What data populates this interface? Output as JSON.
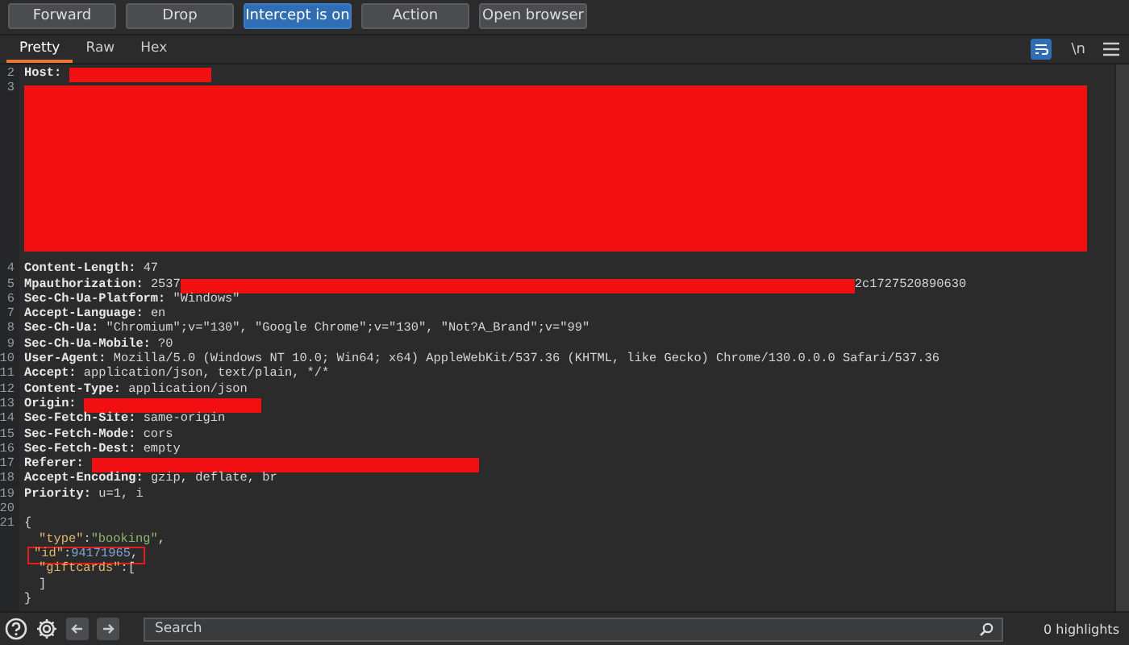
{
  "toolbar": {
    "buttons": [
      {
        "label": "Forward",
        "selected": false
      },
      {
        "label": "Drop",
        "selected": false
      },
      {
        "label": "Intercept is on",
        "selected": true
      },
      {
        "label": "Action",
        "selected": false
      },
      {
        "label": "Open browser",
        "selected": false
      }
    ]
  },
  "view_tabs": [
    {
      "label": "Pretty",
      "selected": true
    },
    {
      "label": "Raw",
      "selected": false
    },
    {
      "label": "Hex",
      "selected": false
    }
  ],
  "view_options": {
    "wrap_lines": {
      "selected": true
    },
    "newline_toggle": {
      "label": "\\n",
      "selected": false
    }
  },
  "editor": {
    "lines": [
      {
        "number": "2",
        "segments": [
          {
            "kind": "header",
            "text": "Host: "
          },
          {
            "kind": "redaction"
          }
        ]
      },
      {
        "number": "3",
        "segments": [
          {
            "kind": "redacted-block"
          }
        ]
      },
      {
        "number": "4",
        "segments": [
          {
            "kind": "header",
            "text": "Content-Length: "
          },
          {
            "kind": "value",
            "text": "47"
          }
        ]
      },
      {
        "number": "5",
        "segments": [
          {
            "kind": "header",
            "text": "Mpauthorization: "
          },
          {
            "kind": "value",
            "text": "2537"
          },
          {
            "kind": "redaction"
          },
          {
            "kind": "value",
            "text": "2c1727520890630"
          }
        ]
      },
      {
        "number": "6",
        "segments": [
          {
            "kind": "header",
            "text": "Sec-Ch-Ua-Platform: "
          },
          {
            "kind": "value",
            "text": "\"Windows\""
          }
        ]
      },
      {
        "number": "7",
        "segments": [
          {
            "kind": "header",
            "text": "Accept-Language: "
          },
          {
            "kind": "value",
            "text": "en"
          }
        ]
      },
      {
        "number": "8",
        "segments": [
          {
            "kind": "header",
            "text": "Sec-Ch-Ua: "
          },
          {
            "kind": "value",
            "text": "\"Chromium\";v=\"130\", \"Google Chrome\";v=\"130\", \"Not?A_Brand\";v=\"99\""
          }
        ]
      },
      {
        "number": "9",
        "segments": [
          {
            "kind": "header",
            "text": "Sec-Ch-Ua-Mobile: "
          },
          {
            "kind": "value",
            "text": "?0"
          }
        ]
      },
      {
        "number": "10",
        "segments": [
          {
            "kind": "header",
            "text": "User-Agent: "
          },
          {
            "kind": "value",
            "text": "Mozilla/5.0 (Windows NT 10.0; Win64; x64) AppleWebKit/537.36 (KHTML, like Gecko) Chrome/130.0.0.0 Safari/537.36"
          }
        ]
      },
      {
        "number": "11",
        "segments": [
          {
            "kind": "header",
            "text": "Accept: "
          },
          {
            "kind": "value",
            "text": "application/json, text/plain, */*"
          }
        ]
      },
      {
        "number": "12",
        "segments": [
          {
            "kind": "header",
            "text": "Content-Type: "
          },
          {
            "kind": "value",
            "text": "application/json"
          }
        ]
      },
      {
        "number": "13",
        "segments": [
          {
            "kind": "header",
            "text": "Origin: "
          },
          {
            "kind": "redaction"
          }
        ]
      },
      {
        "number": "14",
        "segments": [
          {
            "kind": "header",
            "text": "Sec-Fetch-Site: "
          },
          {
            "kind": "value",
            "text": "same-origin"
          }
        ]
      },
      {
        "number": "15",
        "segments": [
          {
            "kind": "header",
            "text": "Sec-Fetch-Mode: "
          },
          {
            "kind": "value",
            "text": "cors"
          }
        ]
      },
      {
        "number": "16",
        "segments": [
          {
            "kind": "header",
            "text": "Sec-Fetch-Dest: "
          },
          {
            "kind": "value",
            "text": "empty"
          }
        ]
      },
      {
        "number": "17",
        "segments": [
          {
            "kind": "header",
            "text": "Referer: "
          },
          {
            "kind": "redaction"
          }
        ]
      },
      {
        "number": "18",
        "segments": [
          {
            "kind": "header",
            "text": "Accept-Encoding: "
          },
          {
            "kind": "value",
            "text": "gzip, deflate, br"
          }
        ]
      },
      {
        "number": "19",
        "segments": [
          {
            "kind": "header",
            "text": "Priority: "
          },
          {
            "kind": "value",
            "text": "u=1, i"
          }
        ]
      },
      {
        "number": "20"
      },
      {
        "number": "21",
        "segments": [
          {
            "kind": "punct",
            "text": "{"
          }
        ]
      },
      {
        "segments": [
          {
            "kind": "indent"
          },
          {
            "kind": "key",
            "text": "\"type\""
          },
          {
            "kind": "punct",
            "text": ":"
          },
          {
            "kind": "string",
            "text": "\"booking\""
          },
          {
            "kind": "punct",
            "text": ","
          }
        ]
      },
      {
        "highlighted": true,
        "segments": [
          {
            "kind": "indent"
          },
          {
            "kind": "key",
            "text": "\"id\""
          },
          {
            "kind": "punct",
            "text": ":"
          },
          {
            "kind": "number",
            "text": "94171965"
          },
          {
            "kind": "punct",
            "text": ","
          }
        ]
      },
      {
        "segments": [
          {
            "kind": "indent"
          },
          {
            "kind": "key",
            "text": "\"giftcards\""
          },
          {
            "kind": "punct",
            "text": ":["
          }
        ]
      },
      {
        "segments": [
          {
            "kind": "indent"
          },
          {
            "kind": "punct",
            "text": "]"
          }
        ]
      },
      {
        "segments": [
          {
            "kind": "punct",
            "text": "}"
          }
        ]
      }
    ]
  },
  "search": {
    "placeholder": "Search"
  },
  "highlights": "0 highlights"
}
